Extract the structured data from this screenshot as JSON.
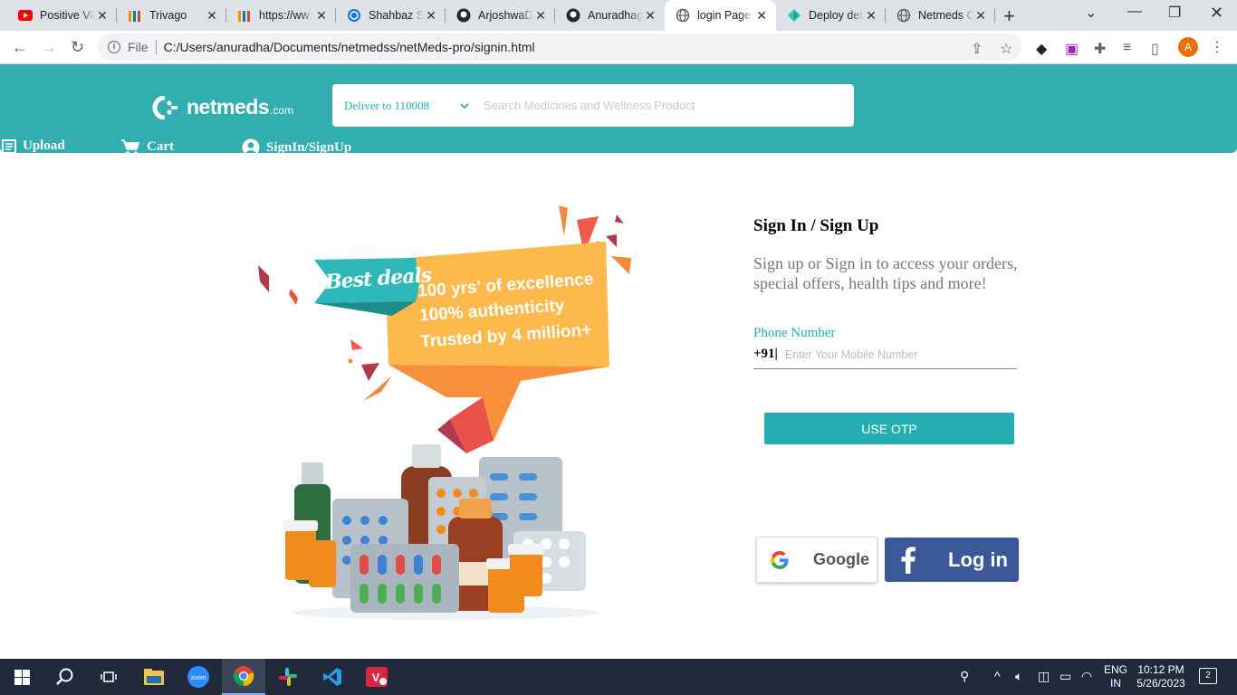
{
  "browser": {
    "tabs": [
      {
        "title": "Positive Vil",
        "icon": "youtube-icon"
      },
      {
        "title": "Trivago",
        "icon": "trivago-icon"
      },
      {
        "title": "https://ww",
        "icon": "trivago-icon"
      },
      {
        "title": "Shahbaz Sl",
        "icon": "globe-icon"
      },
      {
        "title": "ArjoshwaD",
        "icon": "github-icon"
      },
      {
        "title": "Anuradhag",
        "icon": "github-icon"
      },
      {
        "title": "login Page",
        "icon": "globe-icon"
      },
      {
        "title": "Deploy det",
        "icon": "netlify-icon"
      },
      {
        "title": "Netmeds O",
        "icon": "globe-icon"
      }
    ],
    "active_tab": 6,
    "address": {
      "scheme_label": "File",
      "url": "C:/Users/anuradha/Documents/netmedss/netMeds-pro/signin.html"
    },
    "profile_initial": "A"
  },
  "header": {
    "logo_text": "netmeds",
    "logo_suffix": ".com",
    "deliver_label": "Deliver to 110008",
    "search_placeholder": "Search Medicines and Wellness Product",
    "nav": {
      "upload": "Upload",
      "cart": "Cart",
      "signin": "SignIn/SignUp"
    }
  },
  "promo": {
    "badge": "Best deals",
    "lines": [
      "100 yrs' of excellence",
      "100% authenticity",
      "Trusted by 4 million+"
    ]
  },
  "auth": {
    "title": "Sign In / Sign Up",
    "description": "Sign up or Sign in to access your orders, special offers, health tips and more!",
    "phone_label": "Phone Number",
    "country_code": "+91|",
    "phone_placeholder": "Enter Your Mobile Number",
    "otp_button": "USE OTP",
    "google_label": "Google",
    "facebook_label": "Log in"
  },
  "colors": {
    "brand": "#32aeb1",
    "brand_text": "#24aeb1",
    "facebook": "#3b5998"
  },
  "taskbar": {
    "apps": [
      "windows-start-icon",
      "search-icon",
      "task-view-icon",
      "file-explorer-icon",
      "zoom-icon",
      "chrome-icon",
      "slack-icon",
      "vscode-icon",
      "v2-app-icon"
    ],
    "language": "ENG",
    "region": "IN",
    "time": "10:12 PM",
    "date": "5/26/2023",
    "notifications": "2"
  }
}
